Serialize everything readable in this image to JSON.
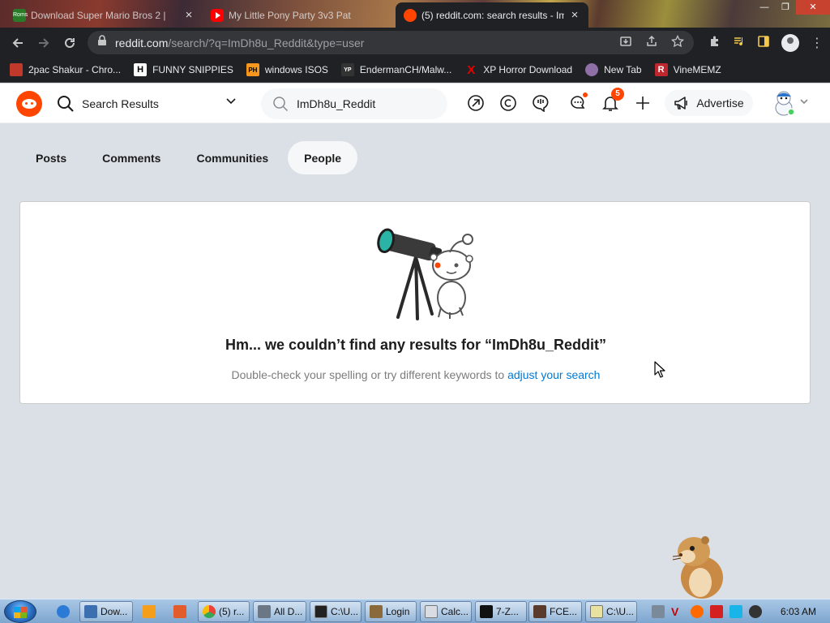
{
  "browser": {
    "tabs": [
      {
        "title": "Download Super Mario Bros 2 |",
        "favicon": "roms-icon",
        "favicon_text": "Roms"
      },
      {
        "title": "My Little Pony Party 3v3 Pat",
        "favicon": "youtube-icon"
      },
      {
        "title": "(5) reddit.com: search results - Im",
        "favicon": "reddit-icon",
        "active": true
      }
    ],
    "close_glyph": "×",
    "url_host": "reddit.com",
    "url_path": "/search/?q=ImDh8u_Reddit&type=user",
    "bookmarks": [
      {
        "label": "2pac Shakur - Chro...",
        "icon": "briefcase-icon",
        "color": "#c0392b"
      },
      {
        "label": "FUNNY SNIPPIES",
        "icon": "h-logo-icon",
        "glyph": "H",
        "color": "#202124"
      },
      {
        "label": "windows ISOS",
        "icon": "ph-logo-icon",
        "glyph": "PH",
        "color": "#f7971d"
      },
      {
        "label": "EndermanCH/Malw...",
        "icon": "yp-logo-icon",
        "glyph": "YP",
        "color": "#333333"
      },
      {
        "label": "XP Horror Download",
        "icon": "red-x-icon",
        "glyph": "X",
        "color": "#e60000"
      },
      {
        "label": "New Tab",
        "icon": "avatar-bookmark-icon",
        "color": "#8e6fa8"
      },
      {
        "label": "VineMEMZ",
        "icon": "r-logo-icon",
        "glyph": "R",
        "color": "#c0262d"
      }
    ]
  },
  "reddit": {
    "header_title": "Search Results",
    "search_query": "ImDh8u_Reddit",
    "notification_count": "5",
    "advertise_label": "Advertise",
    "filter_tabs": [
      "Posts",
      "Comments",
      "Communities",
      "People"
    ],
    "selected_tab": "People",
    "empty_title": "Hm... we couldn’t find any results for “ImDh8u_Reddit”",
    "empty_sub_prefix": "Double-check your spelling or try different keywords to ",
    "empty_sub_link": "adjust your search",
    "accent_color": "#ff4500",
    "link_color": "#0079d3"
  },
  "taskbar": {
    "items": [
      {
        "label": "Dow...",
        "icon": "cursor-app-icon"
      },
      {
        "label": "(5) r...",
        "icon": "chrome-icon"
      },
      {
        "label": "All D...",
        "icon": "window-icon"
      },
      {
        "label": "C:\\U...",
        "icon": "console-icon"
      },
      {
        "label": "Login",
        "icon": "login-icon"
      },
      {
        "label": "Calc...",
        "icon": "calculator-icon"
      },
      {
        "label": "7-Z...",
        "icon": "7zip-icon"
      },
      {
        "label": "FCE...",
        "icon": "fceux-icon"
      },
      {
        "label": "C:\\U...",
        "icon": "notepad-icon"
      }
    ],
    "clock": "6:03 AM"
  }
}
